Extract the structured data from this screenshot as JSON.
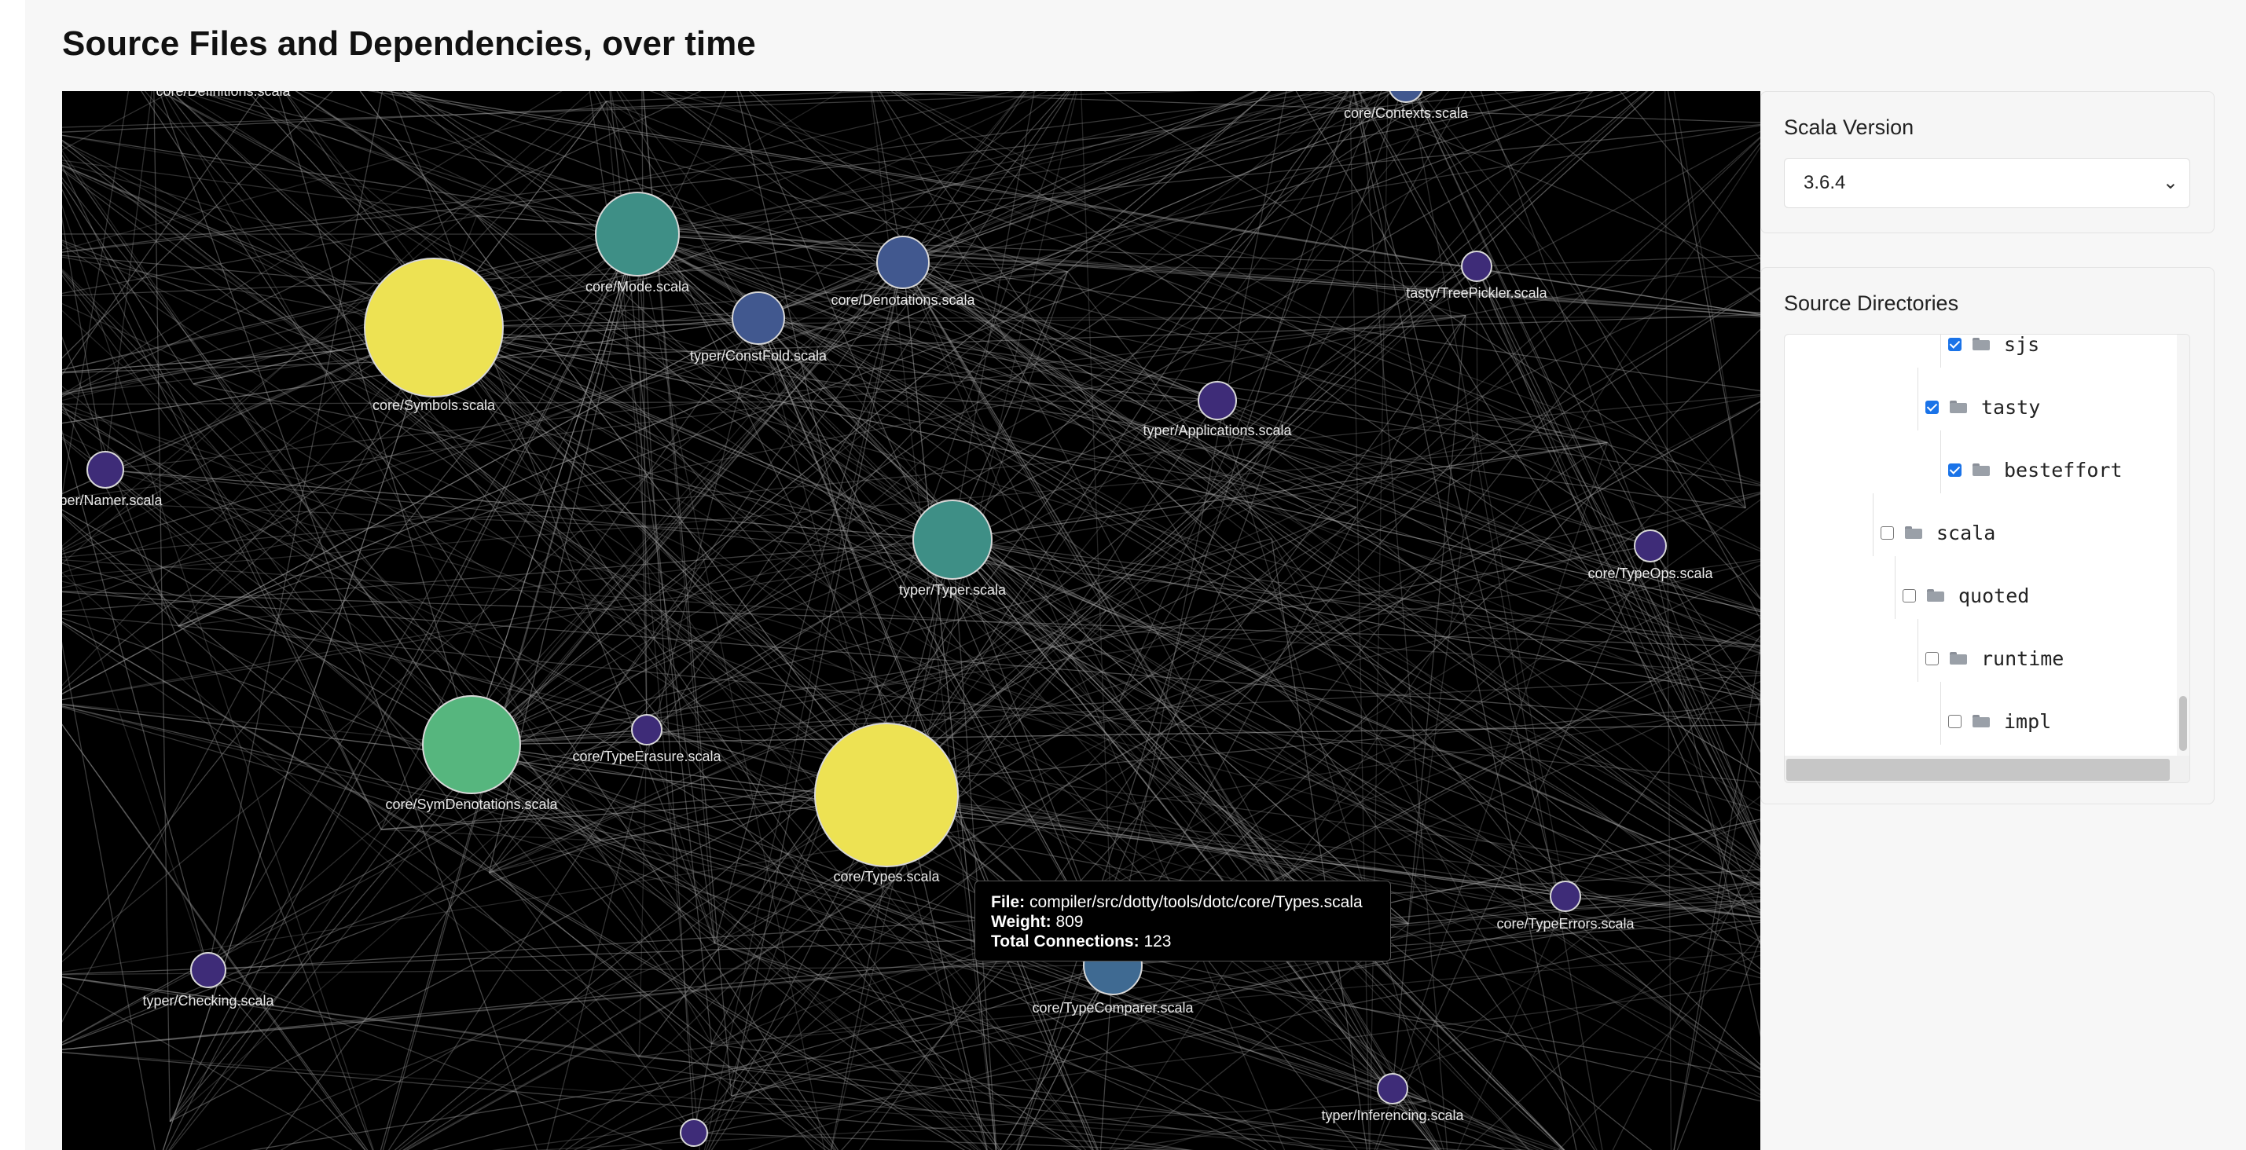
{
  "header": {
    "title": "Source Files and Dependencies, over time"
  },
  "tooltip": {
    "file_label": "File:",
    "file_value": "compiler/src/dotty/tools/dotc/core/Types.scala",
    "weight_label": "Weight:",
    "weight_value": "809",
    "connections_label": "Total Connections:",
    "connections_value": "123"
  },
  "version_panel": {
    "title": "Scala Version",
    "selected": "3.6.4"
  },
  "directories_panel": {
    "title": "Source Directories",
    "items": [
      {
        "label": "sjs",
        "checked": true
      },
      {
        "label": "tasty",
        "checked": true
      },
      {
        "label": "besteffort",
        "checked": true
      },
      {
        "label": "scala",
        "checked": false
      },
      {
        "label": "quoted",
        "checked": false
      },
      {
        "label": "runtime",
        "checked": false
      },
      {
        "label": "impl",
        "checked": false
      }
    ]
  },
  "graph": {
    "colors": {
      "yellow": "#ede253",
      "teal": "#3e8f86",
      "green": "#56b67e",
      "blue": "#41588f",
      "steel": "#3f6a92",
      "purple": "#3e2c78"
    },
    "nodes": [
      {
        "label": "core/Symbols.scala",
        "color": "yellow"
      },
      {
        "label": "core/Types.scala",
        "color": "yellow"
      },
      {
        "label": "core/Mode.scala",
        "color": "teal"
      },
      {
        "label": "typer/Typer.scala",
        "color": "teal"
      },
      {
        "label": "core/SymDenotations.scala",
        "color": "green"
      },
      {
        "label": "core/Denotations.scala",
        "color": "blue"
      },
      {
        "label": "typer/ConstFold.scala",
        "color": "blue"
      },
      {
        "label": "core/TypeComparer.scala",
        "color": "steel"
      },
      {
        "label": "core/Contexts.scala",
        "color": "blue"
      },
      {
        "label": "tasty/TreePickler.scala",
        "color": "purple"
      },
      {
        "label": "typer/Applications.scala",
        "color": "purple"
      },
      {
        "label": "typer/Namer.scala",
        "color": "purple"
      },
      {
        "label": "core/TypeOps.scala",
        "color": "purple"
      },
      {
        "label": "core/TypeErasure.scala",
        "color": "purple"
      },
      {
        "label": "core/TypeErrors.scala",
        "color": "purple"
      },
      {
        "label": "typer/Checking.scala",
        "color": "purple"
      },
      {
        "label": "typer/Inferencing.scala",
        "color": "purple"
      },
      {
        "label": "core/Definitions.scala",
        "color": "purple"
      },
      {
        "label": "",
        "color": "purple"
      }
    ]
  }
}
